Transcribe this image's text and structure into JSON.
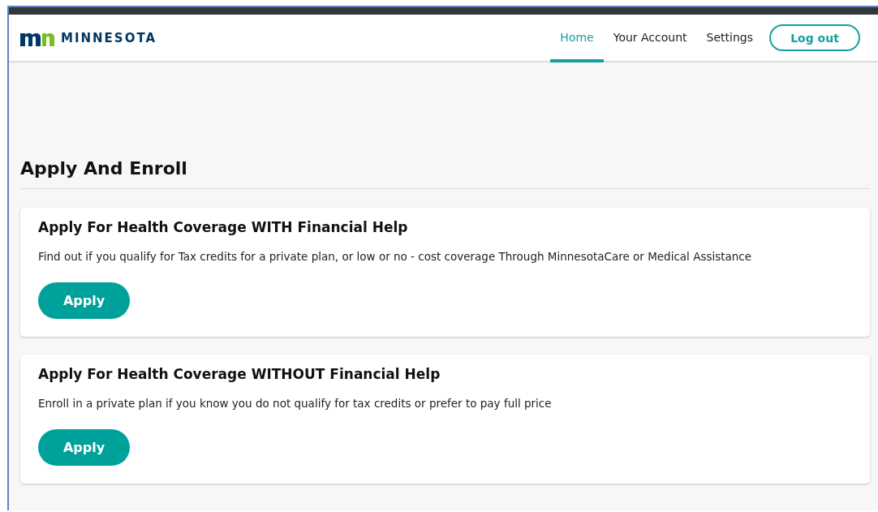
{
  "header": {
    "logo_text": "MINNESOTA",
    "nav": [
      {
        "label": "Home",
        "selected": true
      },
      {
        "label": "Your Account",
        "selected": false
      },
      {
        "label": "Settings",
        "selected": false
      }
    ],
    "logout_button": "Log out"
  },
  "page_title": "Apply And Enroll",
  "cards": [
    {
      "title": "Apply For Health Coverage WITH Financial Help",
      "description": "Find out if you qualify for Tax credits for a private plan, or low or no - cost coverage Through MinnesotaCare or Medical Assistance",
      "button": "Apply"
    },
    {
      "title": "Apply For Health Coverage WITHOUT Financial Help",
      "description": "Enroll in a private plan if you know you do not qualify for tax credits or prefer to pay full price",
      "button": "Apply"
    }
  ]
}
